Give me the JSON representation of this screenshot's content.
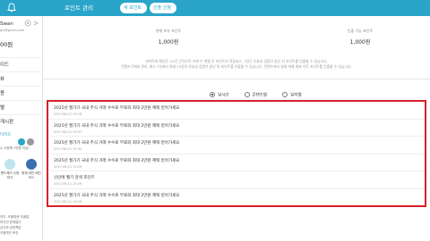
{
  "topbar": {
    "title": "포인트 관리",
    "tab_new": "새 포인트",
    "tab_use": "인출 신청",
    "bell_icon": "bell-icon"
  },
  "sidebar": {
    "name": "Swan",
    "email": "gul@gmail.com",
    "points": "00원",
    "menu": [
      "이드",
      "뷰",
      "용",
      "별",
      "게시판",
      "등",
      "도"
    ],
    "ad_label": "미지도",
    "ad_text": "수 소문에 1만원 지급!",
    "card1": "밴드체크 신청하기",
    "card2": "현재 개인 배진어스",
    "footer": [
      "이다. 도움방문 도움말",
      "미이전 문제없이",
      "금식부 금전책임",
      "이용약관 조건"
    ]
  },
  "stats": {
    "left_label": "현재 보유 포인트",
    "left_value": "1,000원",
    "right_label": "인출 가능 포인트",
    "right_value": "1,000원"
  },
  "notice": [
    "데이트에 해당은 1시간 간격으로 조회 수 계열 후 포인트가 적립되고, 7일간 유효성 검증이 끝난 뒤 포인트를 인출할 수 있습니다.",
    "컨텐츠구매와 관리, 최소 7일에서 최대 15일의 유효성 검증이 끝난 뒤 포인트를 인출할 수 있습니다. 컨텐츠에서 실제 게재 계좌 이후 포인트를 인출할 수 있습니다."
  ],
  "filters": [
    {
      "label": "일시간",
      "selected": true
    },
    {
      "label": "콘텐츠별",
      "selected": false
    },
    {
      "label": "일자별",
      "selected": false
    }
  ],
  "rows": [
    {
      "title": "2025년 월가기 국내 주식 거래 수수료 무료화 최대 2만원 혜택 받아가세요",
      "date": "2017.08.11 15:18"
    },
    {
      "title": "2025년 월가기 국내 주식 거래 수수료 무료화 최대 2만원 혜택 받아가세요",
      "date": "2017.08.11 15:37"
    },
    {
      "title": "2025년 월가기 국내 주식 거래 수수료 무료화 최대 2만원 혜택 받아가세요",
      "date": "2017.08.11 15:34"
    },
    {
      "title": "2025년 월가기 국내 주식 거래 수수료 무료화 최대 2만원 혜택 받아가세요",
      "date": "2017.08.11 15:29"
    },
    {
      "title": "신년에 웰기 검색 포인트",
      "date": "2017.08.11 15:29"
    },
    {
      "title": "2025년 월가기 국내 주식 거래 수수료 무료화 최대 2만원 혜택 받아가세요",
      "date": "2017.08.11 15:18"
    }
  ],
  "colors": {
    "accent": "#2aa4c9",
    "highlight": "#d8202a"
  }
}
